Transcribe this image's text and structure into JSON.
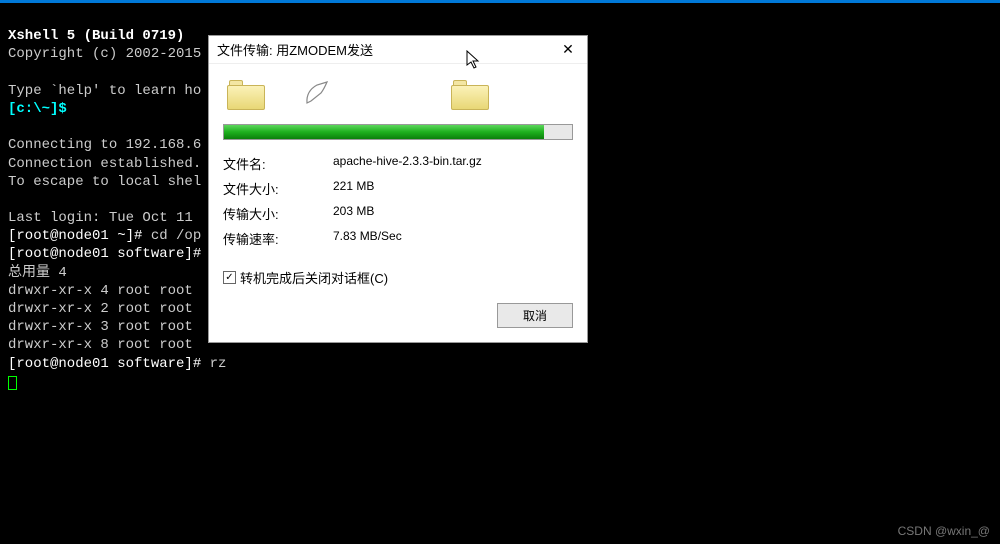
{
  "terminal": {
    "title": "Xshell 5 (Build 0719)",
    "copyright": "Copyright (c) 2002-2015",
    "blank1": "",
    "help_line": "Type `help' to learn ho",
    "prompt_local": "[c:\\~]$",
    "blank2": "",
    "connect1": "Connecting to 192.168.6",
    "connect2": "Connection established.",
    "connect3": "To escape to local shel",
    "blank3": "",
    "lastlogin": "Last login: Tue Oct 11",
    "cmd1_prompt": "[root@node01 ~]# ",
    "cmd1": "cd /op",
    "cmd2_prompt": "[root@node01 software]#",
    "lsline": "总用量 4",
    "ls1": "drwxr-xr-x 4 root root",
    "ls2": "drwxr-xr-x 2 root root",
    "ls3": "drwxr-xr-x 3 root root",
    "ls4": "drwxr-xr-x 8 root root",
    "cmd3_prompt": "[root@node01 software]# ",
    "cmd3": "rz"
  },
  "dialog": {
    "title": "文件传输: 用ZMODEM发送",
    "labels": {
      "filename": "文件名:",
      "filesize": "文件大小:",
      "transferred": "传输大小:",
      "rate": "传输速率:"
    },
    "values": {
      "filename": "apache-hive-2.3.3-bin.tar.gz",
      "filesize": "221 MB",
      "transferred": "203 MB",
      "rate": "7.83 MB/Sec"
    },
    "progress_percent": 92,
    "checkbox_label": "转机完成后关闭对话框(C)",
    "checkbox_checked": true,
    "cancel_button": "取消"
  },
  "watermark": "CSDN @wxin_@"
}
